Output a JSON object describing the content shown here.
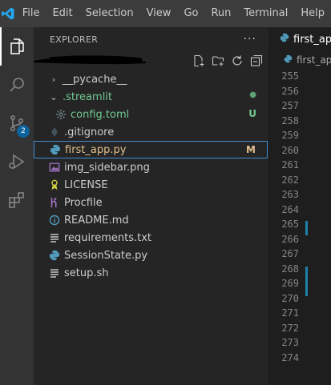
{
  "menu": [
    "File",
    "Edit",
    "Selection",
    "View",
    "Go",
    "Run",
    "Terminal",
    "Help"
  ],
  "activity": {
    "scm_badge": "2"
  },
  "explorer": {
    "title": "EXPLORER",
    "more": "···",
    "files": [
      {
        "name": "__pycache__",
        "type": "folder",
        "chevron": "›",
        "status": ""
      },
      {
        "name": ".streamlit",
        "type": "folder-open",
        "chevron": "⌄",
        "status": "●"
      },
      {
        "name": "config.toml",
        "type": "gear",
        "chevron": "",
        "status": "U"
      },
      {
        "name": ".gitignore",
        "type": "git",
        "chevron": "",
        "status": ""
      },
      {
        "name": "first_app.py",
        "type": "python",
        "chevron": "",
        "status": "M"
      },
      {
        "name": "img_sidebar.png",
        "type": "image",
        "chevron": "",
        "status": ""
      },
      {
        "name": "LICENSE",
        "type": "license",
        "chevron": "",
        "status": ""
      },
      {
        "name": "Procfile",
        "type": "heroku",
        "chevron": "",
        "status": ""
      },
      {
        "name": "README.md",
        "type": "info",
        "chevron": "",
        "status": ""
      },
      {
        "name": "requirements.txt",
        "type": "text",
        "chevron": "",
        "status": ""
      },
      {
        "name": "SessionState.py",
        "type": "python",
        "chevron": "",
        "status": ""
      },
      {
        "name": "setup.sh",
        "type": "text",
        "chevron": "",
        "status": ""
      }
    ]
  },
  "editor": {
    "tab_label": "first_app",
    "breadcrumb": "first_ap",
    "line_numbers": [
      "255",
      "256",
      "257",
      "258",
      "259",
      "260",
      "261",
      "262",
      "263",
      "264",
      "265",
      "266",
      "267",
      "268",
      "269",
      "270",
      "271",
      "272",
      "273",
      "274"
    ]
  },
  "colors": {
    "accent": "#1b81a8",
    "modified": "#e2c08d",
    "untracked": "#73c991",
    "streamlit_green": "#73c991",
    "python_blue": "#519aba"
  }
}
